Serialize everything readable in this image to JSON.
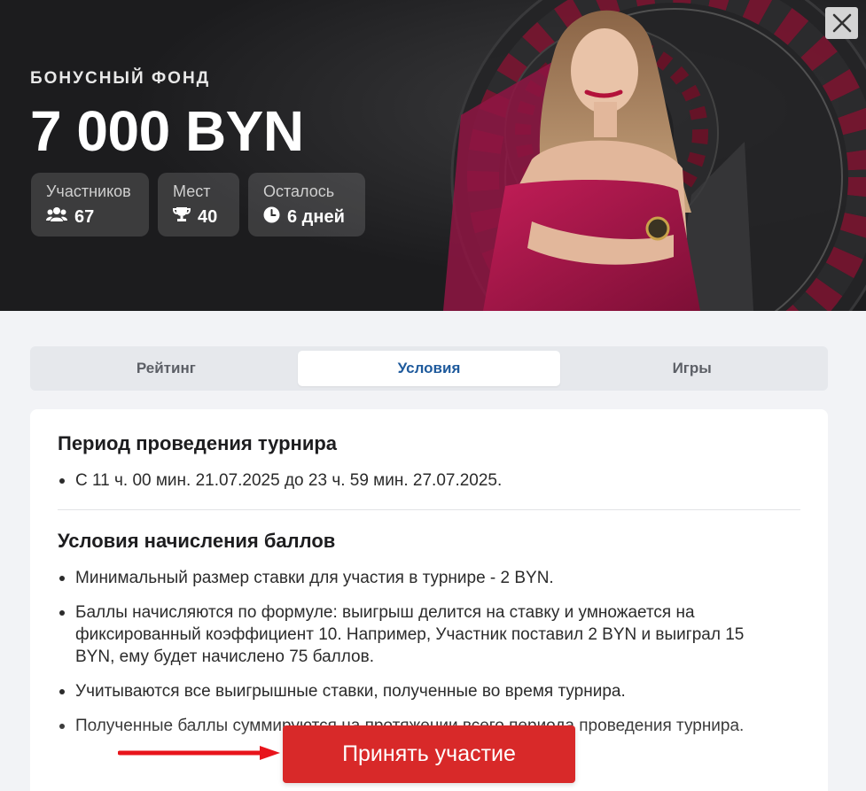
{
  "hero": {
    "kicker": "БОНУСНЫЙ ФОНД",
    "amount": "7 000 BYN",
    "stats": [
      {
        "label": "Участников",
        "value": "67",
        "icon": "users-icon"
      },
      {
        "label": "Мест",
        "value": "40",
        "icon": "trophy-icon"
      },
      {
        "label": "Осталось",
        "value": "6 дней",
        "icon": "clock-icon"
      }
    ]
  },
  "close": {
    "icon": "close-icon"
  },
  "tabs": [
    {
      "label": "Рейтинг",
      "active": false
    },
    {
      "label": "Условия",
      "active": true
    },
    {
      "label": "Игры",
      "active": false
    }
  ],
  "content": {
    "sections": [
      {
        "title": "Период проведения турнира",
        "bullets": [
          "С 11 ч. 00 мин. 21.07.2025 до 23 ч. 59 мин. 27.07.2025."
        ]
      },
      {
        "title": "Условия начисления баллов",
        "bullets": [
          "Минимальный размер ставки для участия в турнире - 2 BYN.",
          "Баллы начисляются по формуле: выигрыш делится на ставку и умножается на фиксированный коэффициент 10. Например, Участник поставил 2 BYN и выиграл 15 BYN, ему будет начислено 75 баллов.",
          "Учитываются все выигрышные ставки, полученные во время турнира.",
          "Полученные баллы суммируются на протяжении всего периода проведения турнира."
        ]
      }
    ]
  },
  "cta": {
    "label": "Принять участие"
  },
  "colors": {
    "accent": "#d82929",
    "active_tab": "#1e5a9c",
    "hero_bg": "#1c1c1e",
    "dress": "#a3164a"
  }
}
